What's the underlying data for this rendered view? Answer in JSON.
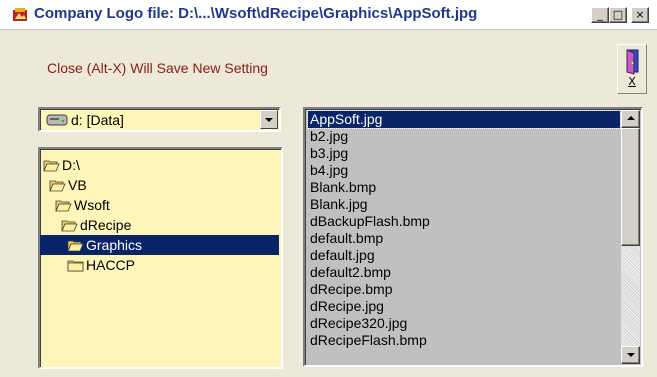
{
  "window": {
    "title": "Company Logo file: D:\\...\\Wsoft\\dRecipe\\Graphics\\AppSoft.jpg",
    "minimize_label": "_",
    "maximize_label": "□",
    "close_label": "×"
  },
  "hint": "Close (Alt-X) Will Save New Setting",
  "exit_button": {
    "label": "X"
  },
  "drive": {
    "label": "d: [Data]"
  },
  "directories": [
    {
      "label": "D:\\"
    },
    {
      "label": "VB"
    },
    {
      "label": "Wsoft"
    },
    {
      "label": "dRecipe"
    },
    {
      "label": "Graphics",
      "selected": true
    },
    {
      "label": "HACCP"
    }
  ],
  "files": [
    {
      "label": "AppSoft.jpg",
      "selected": true
    },
    {
      "label": "b2.jpg"
    },
    {
      "label": "b3.jpg"
    },
    {
      "label": "b4.jpg"
    },
    {
      "label": "Blank.bmp"
    },
    {
      "label": "Blank.jpg"
    },
    {
      "label": "dBackupFlash.bmp"
    },
    {
      "label": "default.bmp"
    },
    {
      "label": "default.jpg"
    },
    {
      "label": "default2.bmp"
    },
    {
      "label": "dRecipe.bmp"
    },
    {
      "label": "dRecipe.jpg"
    },
    {
      "label": "dRecipe320.jpg"
    },
    {
      "label": "dRecipeFlash.bmp"
    }
  ],
  "colors": {
    "list_background": "#fdf6b8",
    "selection": "#0a246a",
    "hint_text": "#8b1a1a",
    "title_text": "#1f3a8a"
  }
}
